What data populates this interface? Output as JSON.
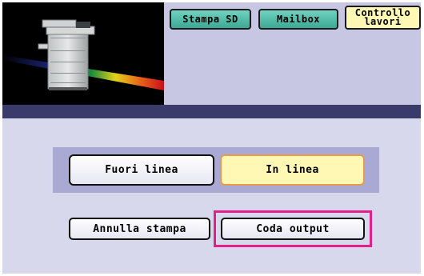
{
  "tabs": {
    "stampa_sd": "Stampa SD",
    "mailbox": "Mailbox",
    "controllo_lavori_line1": "Controllo",
    "controllo_lavori_line2": "lavori"
  },
  "mode": {
    "offline": "Fuori linea",
    "online": "In linea",
    "selected": "In linea"
  },
  "actions": {
    "cancel_print": "Annulla stampa",
    "output_queue": "Coda output"
  },
  "colors": {
    "panel": "#c7c7e3",
    "dark_bar": "#3b3b6b",
    "bottom_panel": "#d8d8ec",
    "tab_teal": "#56c3b0",
    "selected_fill": "#fff8b4",
    "highlight": "#e0218a"
  }
}
